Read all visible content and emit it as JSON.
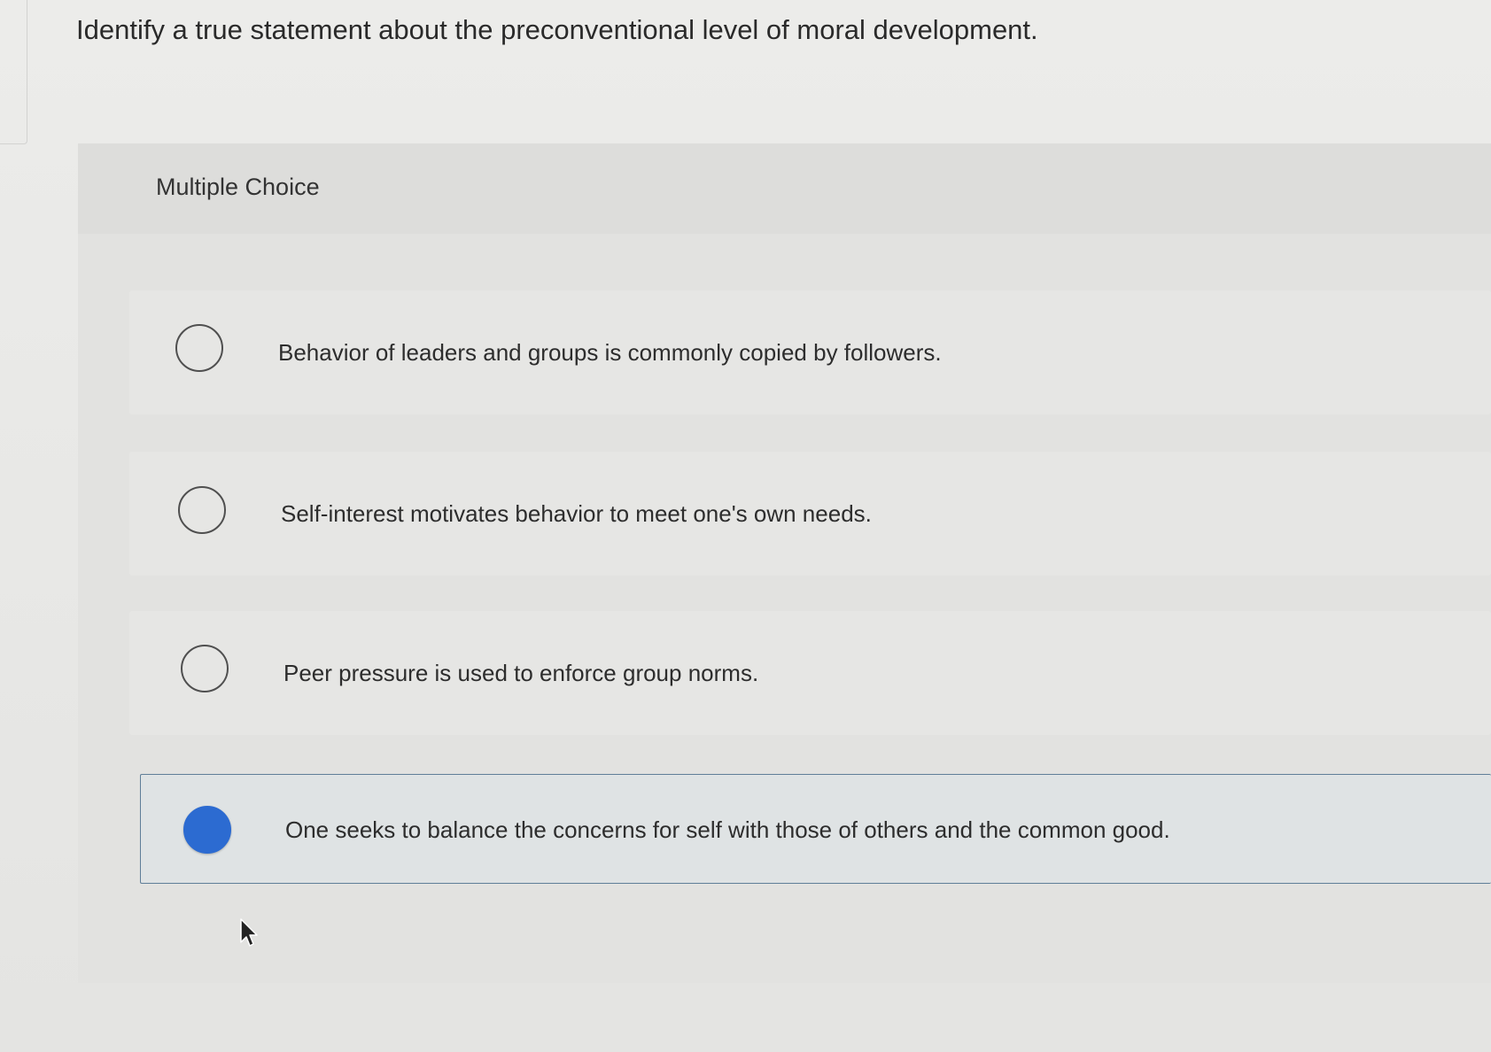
{
  "question": {
    "text": "Identify a true statement about the preconventional level of moral development."
  },
  "panel": {
    "title": "Multiple Choice"
  },
  "options": [
    {
      "label": "Behavior of leaders and groups is commonly copied by followers.",
      "selected": false
    },
    {
      "label": "Self-interest motivates behavior to meet one's own needs.",
      "selected": false
    },
    {
      "label": "Peer pressure is used to enforce group norms.",
      "selected": false
    },
    {
      "label": "One seeks to balance the concerns for self with those of others and the common good.",
      "selected": true
    }
  ],
  "colors": {
    "accent": "#2c6bd1",
    "selected_border": "#5f7e98"
  },
  "icons": {
    "cursor": "mouse-pointer-icon"
  }
}
